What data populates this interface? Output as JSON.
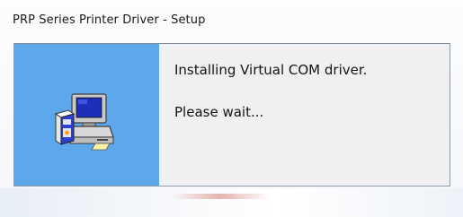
{
  "window": {
    "title": "PRP Series Printer Driver - Setup"
  },
  "dialog": {
    "icon": "computer-setup-icon",
    "message_line1": "Installing Virtual COM driver.",
    "message_line2": "Please wait..."
  },
  "colors": {
    "left_panel": "#5ca8ea",
    "client_bg": "#f0f0f0",
    "border": "#8e9aa7"
  }
}
